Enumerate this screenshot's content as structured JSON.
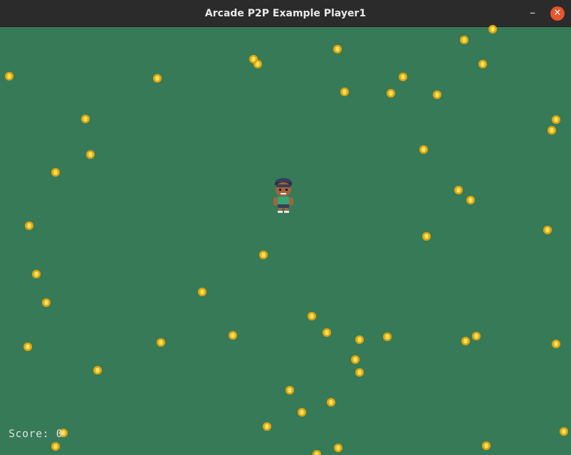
{
  "window": {
    "title": "Arcade P2P Example Player1",
    "minimize_glyph": "–",
    "close_glyph": "✕",
    "close_color": "#e9542c"
  },
  "game": {
    "background_color": "#367a57",
    "coin_color": "#f3c21a",
    "score_label": "Score: 0",
    "player_sprite": "player-character-sprite",
    "coin_icon": "gold-coin-icon"
  }
}
